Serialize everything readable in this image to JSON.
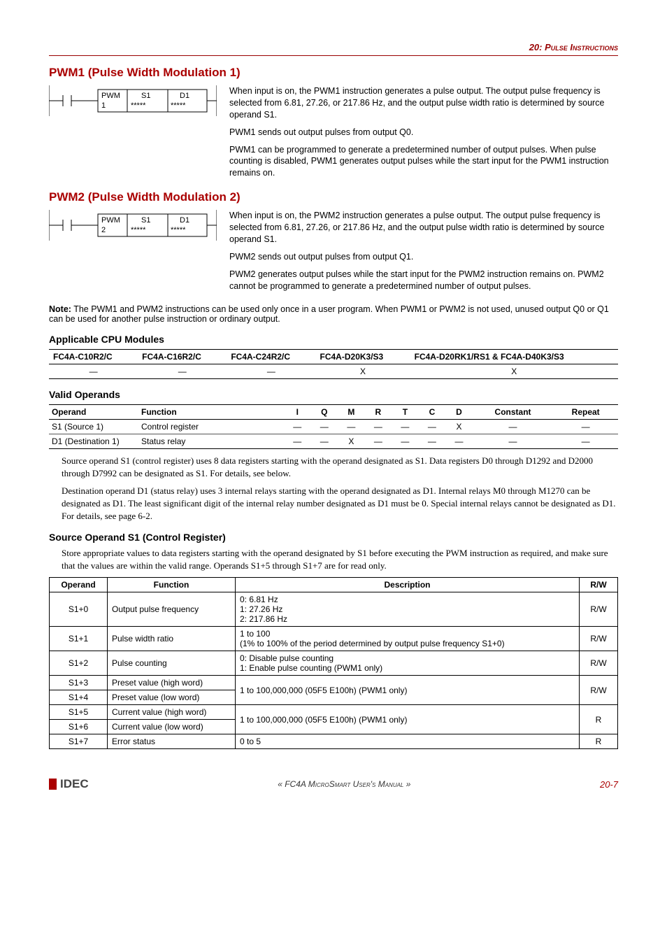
{
  "header": {
    "chapter": "20: Pulse Instructions"
  },
  "sections": {
    "pwm1": {
      "title": "PWM1 (Pulse Width Modulation 1)",
      "ladder": {
        "name": "PWM",
        "num": "1",
        "s1": "S1",
        "s1v": "*****",
        "d1": "D1",
        "d1v": "*****"
      },
      "p1": "When input is on, the PWM1 instruction generates a pulse output. The output pulse frequency is selected from 6.81, 27.26, or 217.86 Hz, and the output pulse width ratio is determined by source operand S1.",
      "p2": "PWM1 sends out output pulses from output Q0.",
      "p3": "PWM1 can be programmed to generate a predetermined number of output pulses. When pulse counting is disabled, PWM1 generates output pulses while the start input for the PWM1 instruction remains on."
    },
    "pwm2": {
      "title": "PWM2 (Pulse Width Modulation 2)",
      "ladder": {
        "name": "PWM",
        "num": "2",
        "s1": "S1",
        "s1v": "*****",
        "d1": "D1",
        "d1v": "*****"
      },
      "p1": "When input is on, the PWM2 instruction generates a pulse output. The output pulse frequency is selected from 6.81, 27.26, or 217.86 Hz, and the output pulse width ratio is determined by source operand S1.",
      "p2": "PWM2 sends out output pulses from output Q1.",
      "p3": "PWM2 generates output pulses while the start input for the PWM2 instruction remains on. PWM2 cannot be programmed to generate a predetermined number of output pulses."
    }
  },
  "note": {
    "label": "Note:",
    "text": "The PWM1 and PWM2 instructions can be used only once in a user program. When PWM1 or PWM2 is not used, unused output Q0 or Q1 can be used for another pulse instruction or ordinary output."
  },
  "cpu": {
    "heading": "Applicable CPU Modules",
    "cols": [
      "FC4A-C10R2/C",
      "FC4A-C16R2/C",
      "FC4A-C24R2/C",
      "FC4A-D20K3/S3",
      "FC4A-D20RK1/RS1 & FC4A-D40K3/S3"
    ],
    "row": [
      "—",
      "—",
      "—",
      "X",
      "X"
    ]
  },
  "valid_operands": {
    "heading": "Valid Operands",
    "head": {
      "operand": "Operand",
      "function": "Function",
      "cols": [
        "I",
        "Q",
        "M",
        "R",
        "T",
        "C",
        "D",
        "Constant",
        "Repeat"
      ]
    },
    "rows": [
      {
        "op": "S1 (Source 1)",
        "fn": "Control register",
        "vals": [
          "—",
          "—",
          "—",
          "—",
          "—",
          "—",
          "X",
          "—",
          "—"
        ]
      },
      {
        "op": "D1 (Destination 1)",
        "fn": "Status relay",
        "vals": [
          "—",
          "—",
          "X",
          "—",
          "—",
          "—",
          "—",
          "—",
          "—"
        ]
      }
    ]
  },
  "body": {
    "p1": "Source operand S1 (control register) uses 8 data registers starting with the operand designated as S1. Data registers D0 through D1292 and D2000 through D7992 can be designated as S1. For details, see below.",
    "p2": "Destination operand D1 (status relay) uses 3 internal relays starting with the operand designated as D1. Internal relays M0 through M1270 can be designated as D1. The least significant digit of the internal relay number designated as D1 must be 0. Special internal relays cannot be designated as D1. For details, see page 6-2."
  },
  "src": {
    "heading": "Source Operand S1 (Control Register)",
    "intro": "Store appropriate values to data registers starting with the operand designated by S1 before executing the PWM instruction as required, and make sure that the values are within the valid range. Operands S1+5 through S1+7 are for read only.",
    "head": {
      "operand": "Operand",
      "function": "Function",
      "description": "Description",
      "rw": "R/W"
    },
    "rows": [
      {
        "op": "S1+0",
        "fn": "Output pulse frequency",
        "desc_lines": [
          "0: 6.81 Hz",
          "1: 27.26 Hz",
          "2: 217.86 Hz"
        ],
        "rw": "R/W"
      },
      {
        "op": "S1+1",
        "fn": "Pulse width ratio",
        "desc_lines": [
          "1 to 100",
          "(1% to 100% of the period determined by output pulse frequency S1+0)"
        ],
        "rw": "R/W"
      },
      {
        "op": "S1+2",
        "fn": "Pulse counting",
        "desc_lines": [
          "0: Disable pulse counting",
          "1: Enable pulse counting (PWM1 only)"
        ],
        "rw": "R/W"
      },
      {
        "op": "S1+3",
        "fn": "Preset value (high word)",
        "desc": "1 to 100,000,000 (05F5 E100h) (PWM1 only)",
        "rw": "R/W",
        "merge_down": true
      },
      {
        "op": "S1+4",
        "fn": "Preset value (low word)"
      },
      {
        "op": "S1+5",
        "fn": "Current value (high word)",
        "desc": "1 to 100,000,000 (05F5 E100h) (PWM1 only)",
        "rw": "R",
        "merge_down": true
      },
      {
        "op": "S1+6",
        "fn": "Current value (low word)"
      },
      {
        "op": "S1+7",
        "fn": "Error status",
        "desc": "0 to 5",
        "rw": "R"
      }
    ]
  },
  "footer": {
    "logo": "IDEC",
    "center": "« FC4A MicroSmart User's Manual »",
    "page": "20-7"
  }
}
